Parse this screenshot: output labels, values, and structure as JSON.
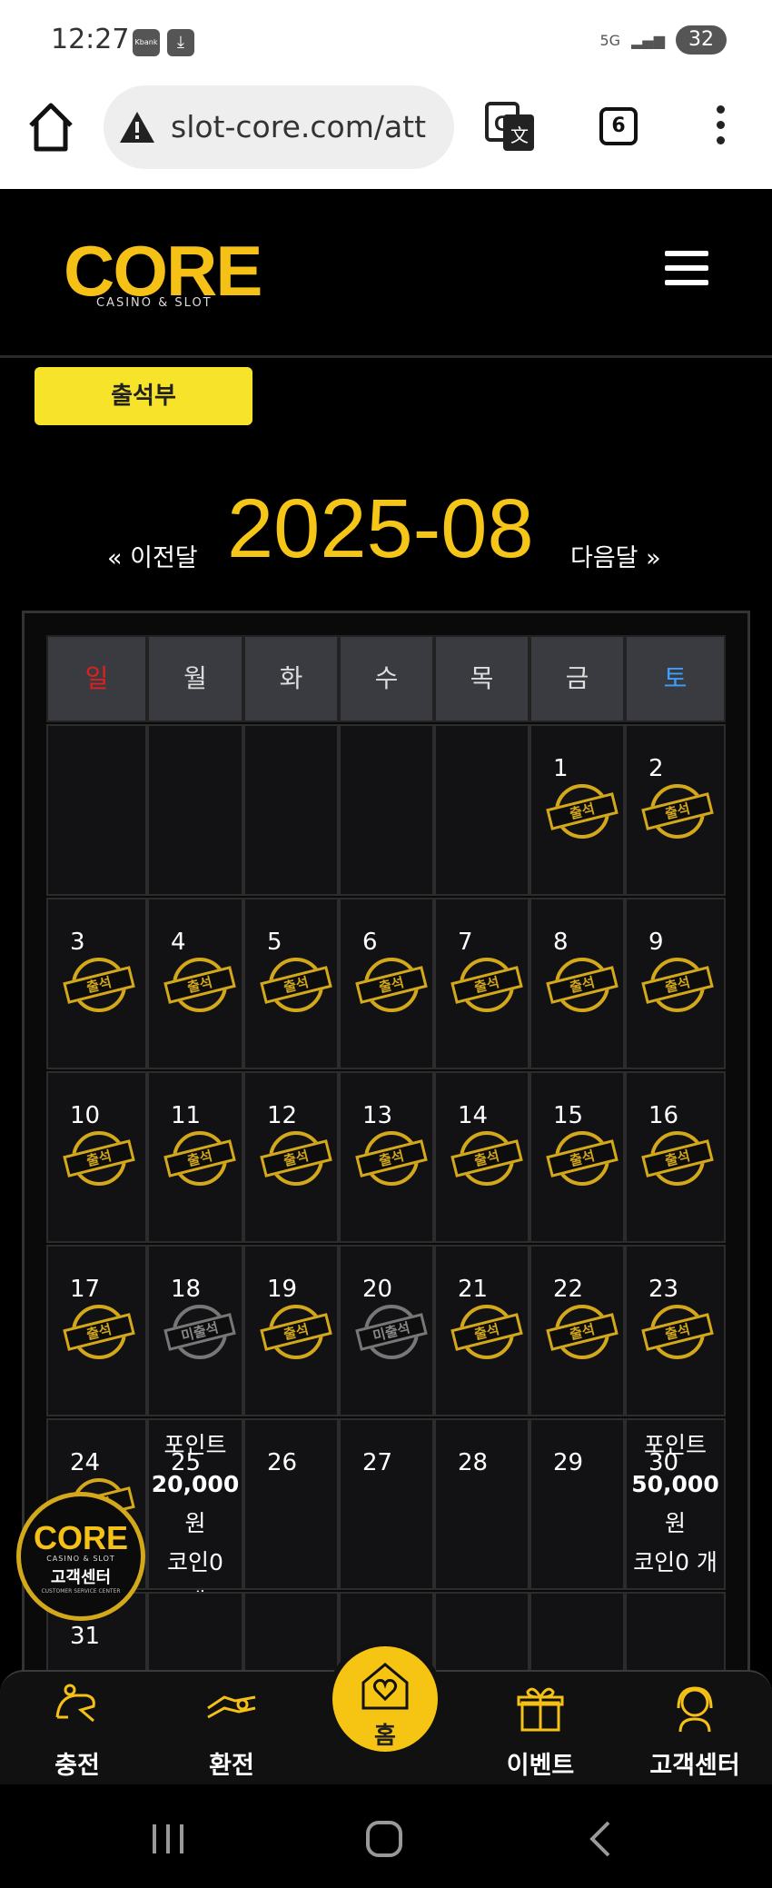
{
  "status_bar": {
    "time": "12:27",
    "app_icons": [
      "Kbank",
      "download"
    ],
    "network": "5G",
    "battery": "32"
  },
  "browser": {
    "url": "slot-core.com/att",
    "tab_count": "6"
  },
  "site": {
    "logo_text": "CORE",
    "logo_sub": "CASINO & SLOT",
    "attendance_button": "출석부"
  },
  "calendar": {
    "prev_label": "« 이전달",
    "next_label": "다음달 »",
    "month": "2025-08",
    "weekdays": [
      "일",
      "월",
      "화",
      "수",
      "목",
      "금",
      "토"
    ],
    "weekday_colors": [
      "#e0201c",
      "#dddddd",
      "#dddddd",
      "#dddddd",
      "#dddddd",
      "#dddddd",
      "#3aa0ff"
    ],
    "stamp_attended": "출석",
    "stamp_missed": "미출석",
    "weeks": [
      [
        null,
        null,
        null,
        null,
        null,
        {
          "day": "1",
          "status": "attended"
        },
        {
          "day": "2",
          "status": "attended"
        }
      ],
      [
        {
          "day": "3",
          "status": "attended"
        },
        {
          "day": "4",
          "status": "attended"
        },
        {
          "day": "5",
          "status": "attended"
        },
        {
          "day": "6",
          "status": "attended"
        },
        {
          "day": "7",
          "status": "attended"
        },
        {
          "day": "8",
          "status": "attended"
        },
        {
          "day": "9",
          "status": "attended"
        }
      ],
      [
        {
          "day": "10",
          "status": "attended"
        },
        {
          "day": "11",
          "status": "attended"
        },
        {
          "day": "12",
          "status": "attended"
        },
        {
          "day": "13",
          "status": "attended"
        },
        {
          "day": "14",
          "status": "attended"
        },
        {
          "day": "15",
          "status": "attended"
        },
        {
          "day": "16",
          "status": "attended"
        }
      ],
      [
        {
          "day": "17",
          "status": "attended"
        },
        {
          "day": "18",
          "status": "missed"
        },
        {
          "day": "19",
          "status": "attended"
        },
        {
          "day": "20",
          "status": "missed"
        },
        {
          "day": "21",
          "status": "attended"
        },
        {
          "day": "22",
          "status": "attended"
        },
        {
          "day": "23",
          "status": "attended"
        }
      ],
      [
        {
          "day": "24",
          "status": "attended"
        },
        {
          "day": "25",
          "status": "none",
          "reward": [
            "포인트",
            "20,000",
            "원",
            "코인0",
            "개"
          ]
        },
        {
          "day": "26",
          "status": "none"
        },
        {
          "day": "27",
          "status": "none"
        },
        {
          "day": "28",
          "status": "none"
        },
        {
          "day": "29",
          "status": "none"
        },
        {
          "day": "30",
          "status": "none",
          "reward": [
            "포인트",
            "50,000",
            "원",
            "코인0 개"
          ]
        }
      ],
      [
        {
          "day": "31",
          "status": "none"
        },
        null,
        null,
        null,
        null,
        null,
        null
      ]
    ]
  },
  "floating_badge": {
    "logo": "CORE",
    "sub": "CASINO & SLOT",
    "label": "고객센터",
    "small": "CUSTOMER SERVICE CENTER"
  },
  "bottom_nav": {
    "charge": "충전",
    "exchange": "환전",
    "home": "홈",
    "event": "이벤트",
    "support": "고객센터"
  }
}
